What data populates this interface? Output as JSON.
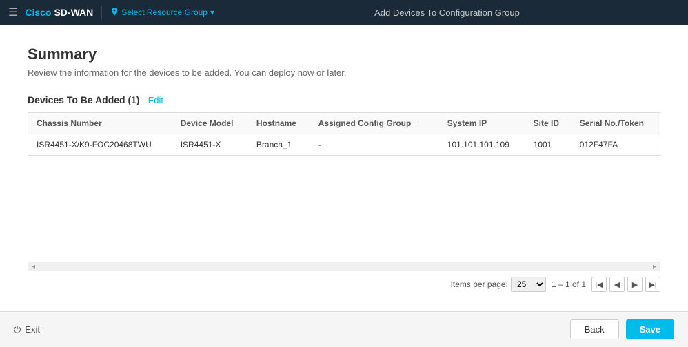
{
  "nav": {
    "hamburger_icon": "☰",
    "brand_cisco": "Cisco",
    "brand_sdwan": "SD-WAN",
    "resource_group_label": "Select Resource Group",
    "resource_group_dropdown_icon": "▾",
    "location_icon": "📍",
    "page_title": "Add Devices To Configuration Group"
  },
  "summary": {
    "title": "Summary",
    "subtitle": "Review the information for the devices to be added. You can deploy now or later.",
    "section_title": "Devices To Be Added (1)",
    "edit_label": "Edit",
    "table": {
      "columns": [
        {
          "key": "chassis_number",
          "label": "Chassis Number",
          "sortable": false
        },
        {
          "key": "device_model",
          "label": "Device Model",
          "sortable": false
        },
        {
          "key": "hostname",
          "label": "Hostname",
          "sortable": false
        },
        {
          "key": "assigned_config_group",
          "label": "Assigned Config Group",
          "sortable": true
        },
        {
          "key": "system_ip",
          "label": "System IP",
          "sortable": false
        },
        {
          "key": "site_id",
          "label": "Site ID",
          "sortable": false
        },
        {
          "key": "serial_no_token",
          "label": "Serial No./Token",
          "sortable": false
        }
      ],
      "rows": [
        {
          "chassis_number": "ISR4451-X/K9-FOC20468TWU",
          "device_model": "ISR4451-X",
          "hostname": "Branch_1",
          "assigned_config_group": "-",
          "system_ip": "101.101.101.109",
          "site_id": "1001",
          "serial_no_token": "012F47FA"
        }
      ]
    }
  },
  "pagination": {
    "items_per_page_label": "Items per page:",
    "items_per_page_value": "25",
    "items_per_page_options": [
      "10",
      "25",
      "50",
      "100"
    ],
    "range_text": "1 – 1 of 1",
    "first_icon": "|◀",
    "prev_icon": "◀",
    "next_icon": "▶",
    "last_icon": "▶|"
  },
  "footer": {
    "exit_icon": "⏻",
    "exit_label": "Exit",
    "back_label": "Back",
    "save_label": "Save"
  }
}
